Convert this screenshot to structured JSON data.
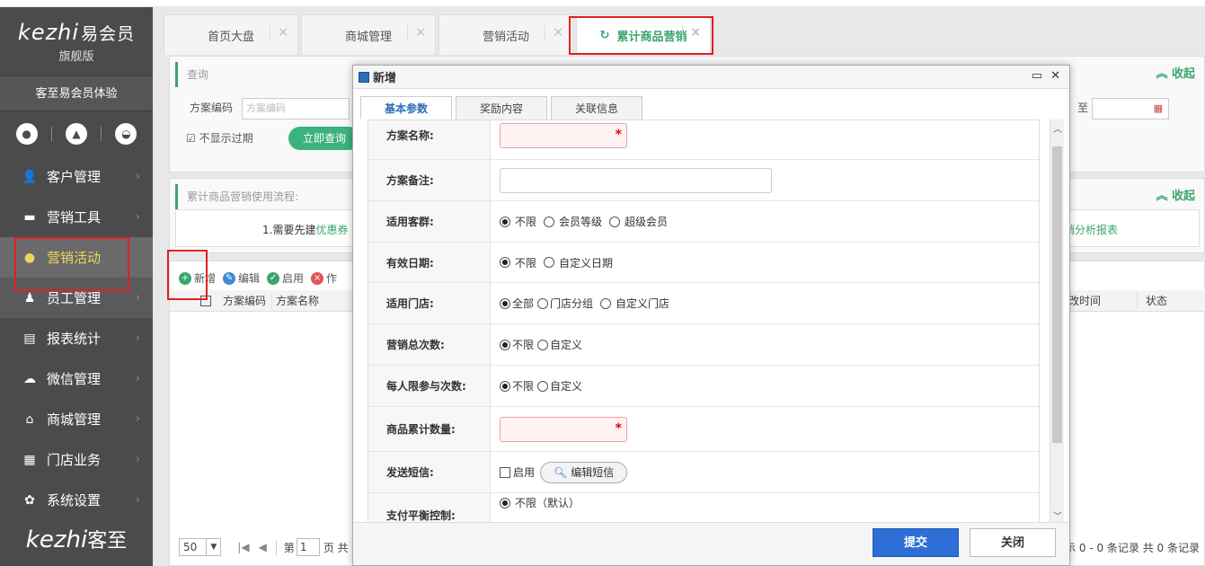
{
  "sidebar": {
    "brand": "kezhi",
    "brand_cn": "易会员",
    "edition": "旗舰版",
    "org_name": "客至易会员体验",
    "menu": [
      {
        "label": "客户管理",
        "icon": "👤"
      },
      {
        "label": "营销工具",
        "icon": "▬"
      },
      {
        "label": "营销活动",
        "icon": "●"
      },
      {
        "label": "员工管理",
        "icon": "♟"
      },
      {
        "label": "报表统计",
        "icon": "▤"
      },
      {
        "label": "微信管理",
        "icon": "☁"
      },
      {
        "label": "商城管理",
        "icon": "⌂"
      },
      {
        "label": "门店业务",
        "icon": "▦"
      },
      {
        "label": "系统设置",
        "icon": "✿"
      }
    ],
    "footer_brand": "kezhi",
    "footer_brand_cn": "客至"
  },
  "tabs": [
    {
      "label": "首页大盘"
    },
    {
      "label": "商城管理"
    },
    {
      "label": "营销活动"
    },
    {
      "label": "累计商品营销"
    }
  ],
  "query": {
    "title": "查询",
    "collapse": "收起",
    "code_label": "方案编码",
    "code_placeholder": "方案编码",
    "hide_expired": "不显示过期",
    "search_btn": "立即查询",
    "to": "至"
  },
  "flow": {
    "title": "累计商品营销使用流程:",
    "collapse": "收起",
    "step1": "1.需要先建",
    "step1_link": "优惠券",
    "report_link": "销分析报表"
  },
  "toolbar": {
    "add": "新增",
    "edit": "编辑",
    "enable": "启用",
    "more": "作"
  },
  "grid": {
    "col_code": "方案编码",
    "col_name": "方案名称",
    "col_time": "改时间",
    "col_status": "状态"
  },
  "pager": {
    "size": "50",
    "page_prefix": "第",
    "page": "1",
    "page_suffix": "页 共",
    "summary": "示 0 - 0 条记录 共 0 条记录"
  },
  "modal": {
    "title": "新增",
    "tabs": [
      "基本参数",
      "奖励内容",
      "关联信息"
    ],
    "fields": {
      "name": "方案名称:",
      "note": "方案备注:",
      "group": "适用客群:",
      "group_opts": [
        "不限",
        "会员等级",
        "超级会员"
      ],
      "date": "有效日期:",
      "date_opts": [
        "不限",
        "自定义日期"
      ],
      "store": "适用门店:",
      "store_opts": [
        "全部",
        "门店分组",
        "自定义门店"
      ],
      "total": "营销总次数:",
      "total_opts": [
        "不限",
        "自定义"
      ],
      "per": "每人限参与次数:",
      "per_opts": [
        "不限",
        "自定义"
      ],
      "qty": "商品累计数量:",
      "sms": "发送短信:",
      "sms_enable": "启用",
      "sms_btn": "编辑短信",
      "pay": "支付平衡控制:",
      "pay_opt": "不限（默认）"
    },
    "submit": "提交",
    "close": "关闭"
  },
  "colors": {
    "accent": "#3aa56f",
    "primary": "#2d6fd6",
    "highlight": "#e02020"
  }
}
